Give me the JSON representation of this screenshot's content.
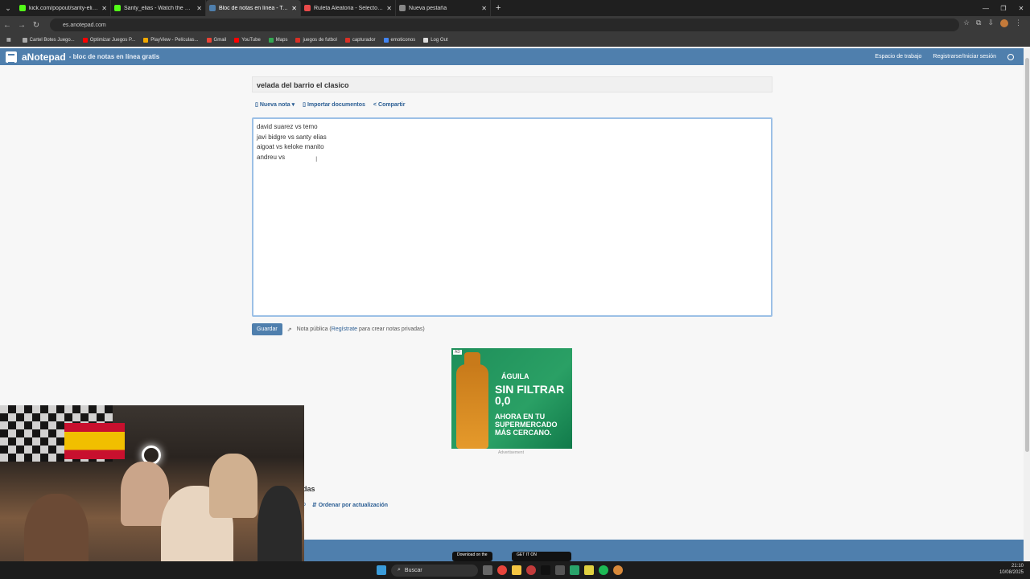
{
  "browser": {
    "tabs": [
      {
        "title": "kick.com/popout/santy-elias/ch",
        "color": "#53fc18",
        "active": false
      },
      {
        "title": "Santy_elias - Watch the VOD of",
        "color": "#53fc18",
        "active": false
      },
      {
        "title": "Bloc de notas en línea - Toma y",
        "color": "#4f7fad",
        "active": true
      },
      {
        "title": "Ruleta Aleatoria - Selector Pers",
        "color": "#e84a4a",
        "active": false
      },
      {
        "title": "Nueva pestaña",
        "color": "#888888",
        "active": false
      }
    ],
    "new_tab": "+",
    "url": "es.anotepad.com",
    "bookmarks": [
      {
        "label": "Cartel Botes Juego...",
        "color": "#aaaaaa"
      },
      {
        "label": "Optimizar Juegos P...",
        "color": "#ff0000"
      },
      {
        "label": "PlayView - Películas...",
        "color": "#f2a900"
      },
      {
        "label": "Gmail",
        "color": "#ea4335"
      },
      {
        "label": "YouTube",
        "color": "#ff0000"
      },
      {
        "label": "Maps",
        "color": "#34a853"
      },
      {
        "label": "juegos de futbol",
        "color": "#d93025"
      },
      {
        "label": "capturador",
        "color": "#d93025"
      },
      {
        "label": "emoticonos",
        "color": "#4285f4"
      },
      {
        "label": "Log Out",
        "color": "#dddddd"
      }
    ]
  },
  "site": {
    "brand": "aNotepad",
    "tagline": "- bloc de notas en línea gratis",
    "workspace": "Espacio de trabajo",
    "login": "Registrarse/Iniciar sesión",
    "accent": "#4f7fad"
  },
  "note": {
    "title": "velada del barrio el clasico",
    "actions": {
      "new_note": "Nueva nota",
      "import": "Importar documentos",
      "share": "Compartir"
    },
    "lines": [
      "david suarez vs temo",
      "javi bidgre vs santy elias",
      "aigoat vs keloke manito",
      "andreu vs"
    ],
    "save": "Guardar",
    "public_prefix": "Nota pública (",
    "register": "Regístrate",
    "public_suffix": " para crear notas privadas)"
  },
  "ad": {
    "tag": "AD",
    "brand": "ÁGUILA",
    "headline": "SIN FILTRAR 0,0",
    "sub": "AHORA EN TU SUPERMERCADO MÁS CERCANO.",
    "caption": "Advertisement"
  },
  "below": {
    "heading_fragment": "das",
    "fragment": "o",
    "sort": "Ordenar por actualización"
  },
  "stores": {
    "apple": "Download on the",
    "google": "GET IT ON"
  },
  "taskbar": {
    "search": "Buscar",
    "time": "21:10",
    "date": "10/08/2025"
  }
}
